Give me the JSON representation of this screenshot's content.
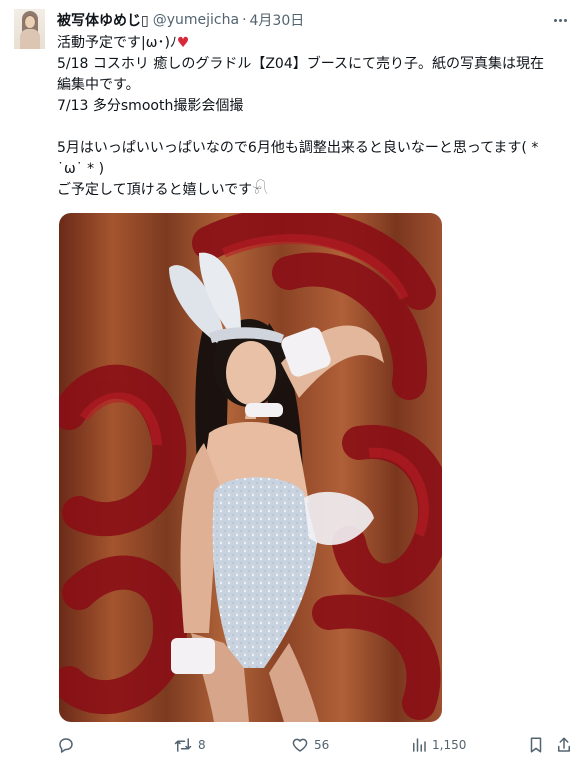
{
  "tweet": {
    "author_name": "被写体ゆめじ▯",
    "author_handle": "@yumejicha",
    "separator": "·",
    "date": "4月30日",
    "lines": [
      "活動予定です|ω･)ﾉ♥",
      "5/18 コスホリ 癒しのグラドル【Z04】ブースにて売り子。紙の写真集は現在",
      "編集中です。",
      "7/13 多分smooth撮影会個撮",
      "",
      "5月はいっぱいいっぱいなので6月他も調整出来ると良いなーと思ってます( *",
      "˙ω˙ * )",
      "ご予定して頂けると嬉しいです𓍯"
    ],
    "media_alt": "photo"
  },
  "actions": {
    "reply_count": "",
    "retweet_count": "8",
    "like_count": "56",
    "view_count": "1,150"
  },
  "icons": {
    "more": "more-horizontal-icon",
    "reply": "reply-icon",
    "retweet": "retweet-icon",
    "like": "heart-icon",
    "views": "analytics-icon",
    "bookmark": "bookmark-icon",
    "share": "share-icon"
  },
  "colors": {
    "text": "#0f1419",
    "secondary": "#536471",
    "heart_emoji": "#d62a3b"
  }
}
